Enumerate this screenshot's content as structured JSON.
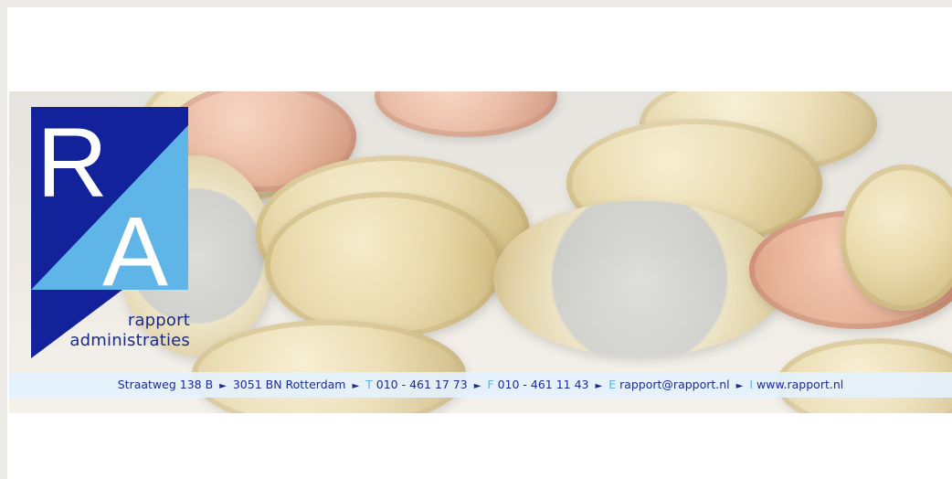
{
  "brand": {
    "logo_letters": [
      "R",
      "A"
    ],
    "name_line1": "rapport",
    "name_line2": "administraties",
    "colors": {
      "dark_blue": "#12229a",
      "light_blue": "#5fb4e8",
      "white": "#ffffff"
    }
  },
  "contact": {
    "address": "Straatweg 138 B",
    "city": "3051 BN Rotterdam",
    "separator": "►",
    "phone_key": "T",
    "phone": "010 - 461 17 73",
    "fax_key": "F",
    "fax": "010 - 461 11 43",
    "email_key": "E",
    "email": "rapport@rapport.nl",
    "web_key": "I",
    "web": "www.rapport.nl"
  }
}
